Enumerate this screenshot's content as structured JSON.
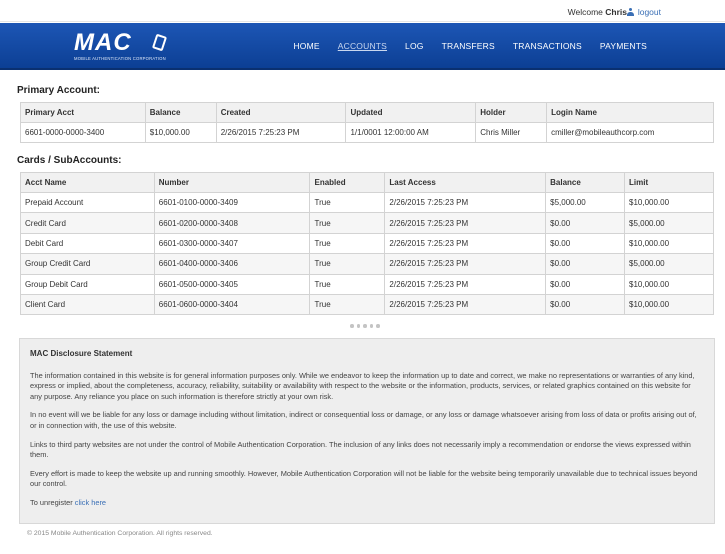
{
  "topbar": {
    "welcome_prefix": "Welcome",
    "user_name": "Chris",
    "logout_label": "logout"
  },
  "logo": {
    "text": "MAC",
    "subtitle": "MOBILE AUTHENTICATION CORPORATION"
  },
  "nav": {
    "items": [
      "HOME",
      "ACCOUNTS",
      "LOG",
      "TRANSFERS",
      "TRANSACTIONS",
      "PAYMENTS"
    ],
    "active": "ACCOUNTS"
  },
  "primary": {
    "title": "Primary Account:",
    "headers": [
      "Primary Acct",
      "Balance",
      "Created",
      "Updated",
      "Holder",
      "Login Name"
    ],
    "row": [
      "6601-0000-0000-3400",
      "$10,000.00",
      "2/26/2015 7:25:23 PM",
      "1/1/0001 12:00:00 AM",
      "Chris Miller",
      "cmiller@mobileauthcorp.com"
    ]
  },
  "cards": {
    "title": "Cards / SubAccounts:",
    "headers": [
      "Acct Name",
      "Number",
      "Enabled",
      "Last Access",
      "Balance",
      "Limit"
    ],
    "rows": [
      [
        "Prepaid Account",
        "6601-0100-0000-3409",
        "True",
        "2/26/2015 7:25:23 PM",
        "$5,000.00",
        "$10,000.00"
      ],
      [
        "Credit Card",
        "6601-0200-0000-3408",
        "True",
        "2/26/2015 7:25:23 PM",
        "$0.00",
        "$5,000.00"
      ],
      [
        "Debit Card",
        "6601-0300-0000-3407",
        "True",
        "2/26/2015 7:25:23 PM",
        "$0.00",
        "$10,000.00"
      ],
      [
        "Group Credit Card",
        "6601-0400-0000-3406",
        "True",
        "2/26/2015 7:25:23 PM",
        "$0.00",
        "$5,000.00"
      ],
      [
        "Group Debit Card",
        "6601-0500-0000-3405",
        "True",
        "2/26/2015 7:25:23 PM",
        "$0.00",
        "$10,000.00"
      ],
      [
        "Client Card",
        "6601-0600-0000-3404",
        "True",
        "2/26/2015 7:25:23 PM",
        "$0.00",
        "$10,000.00"
      ]
    ]
  },
  "disclosure": {
    "title": "MAC Disclosure Statement",
    "p1": "The information contained in this website is for general information purposes only. While we endeavor to keep the information up to date and correct, we make no representations or warranties of any kind, express or implied, about the completeness, accuracy, reliability, suitability or availability with respect to the website or the information, products, services, or related graphics contained on this website for any purpose. Any reliance you place on such information is therefore strictly at your own risk.",
    "p2": "In no event will we be liable for any loss or damage including without limitation, indirect or consequential loss or damage, or any loss or damage whatsoever arising from loss of data or profits arising out of, or in connection with, the use of this website.",
    "p3": "Links to third party websites are not under the control of Mobile Authentication Corporation. The inclusion of any links does not necessarily imply a recommendation or endorse the views expressed within them.",
    "p4": "Every effort is made to keep the website up and running smoothly. However, Mobile Authentication Corporation will not be liable for the website being temporarily unavailable due to technical issues beyond our control.",
    "unregister_prefix": "To unregister",
    "unregister_link": "click here"
  },
  "footer": {
    "copyright": "© 2015 Mobile Authentication Corporation. All rights reserved."
  }
}
